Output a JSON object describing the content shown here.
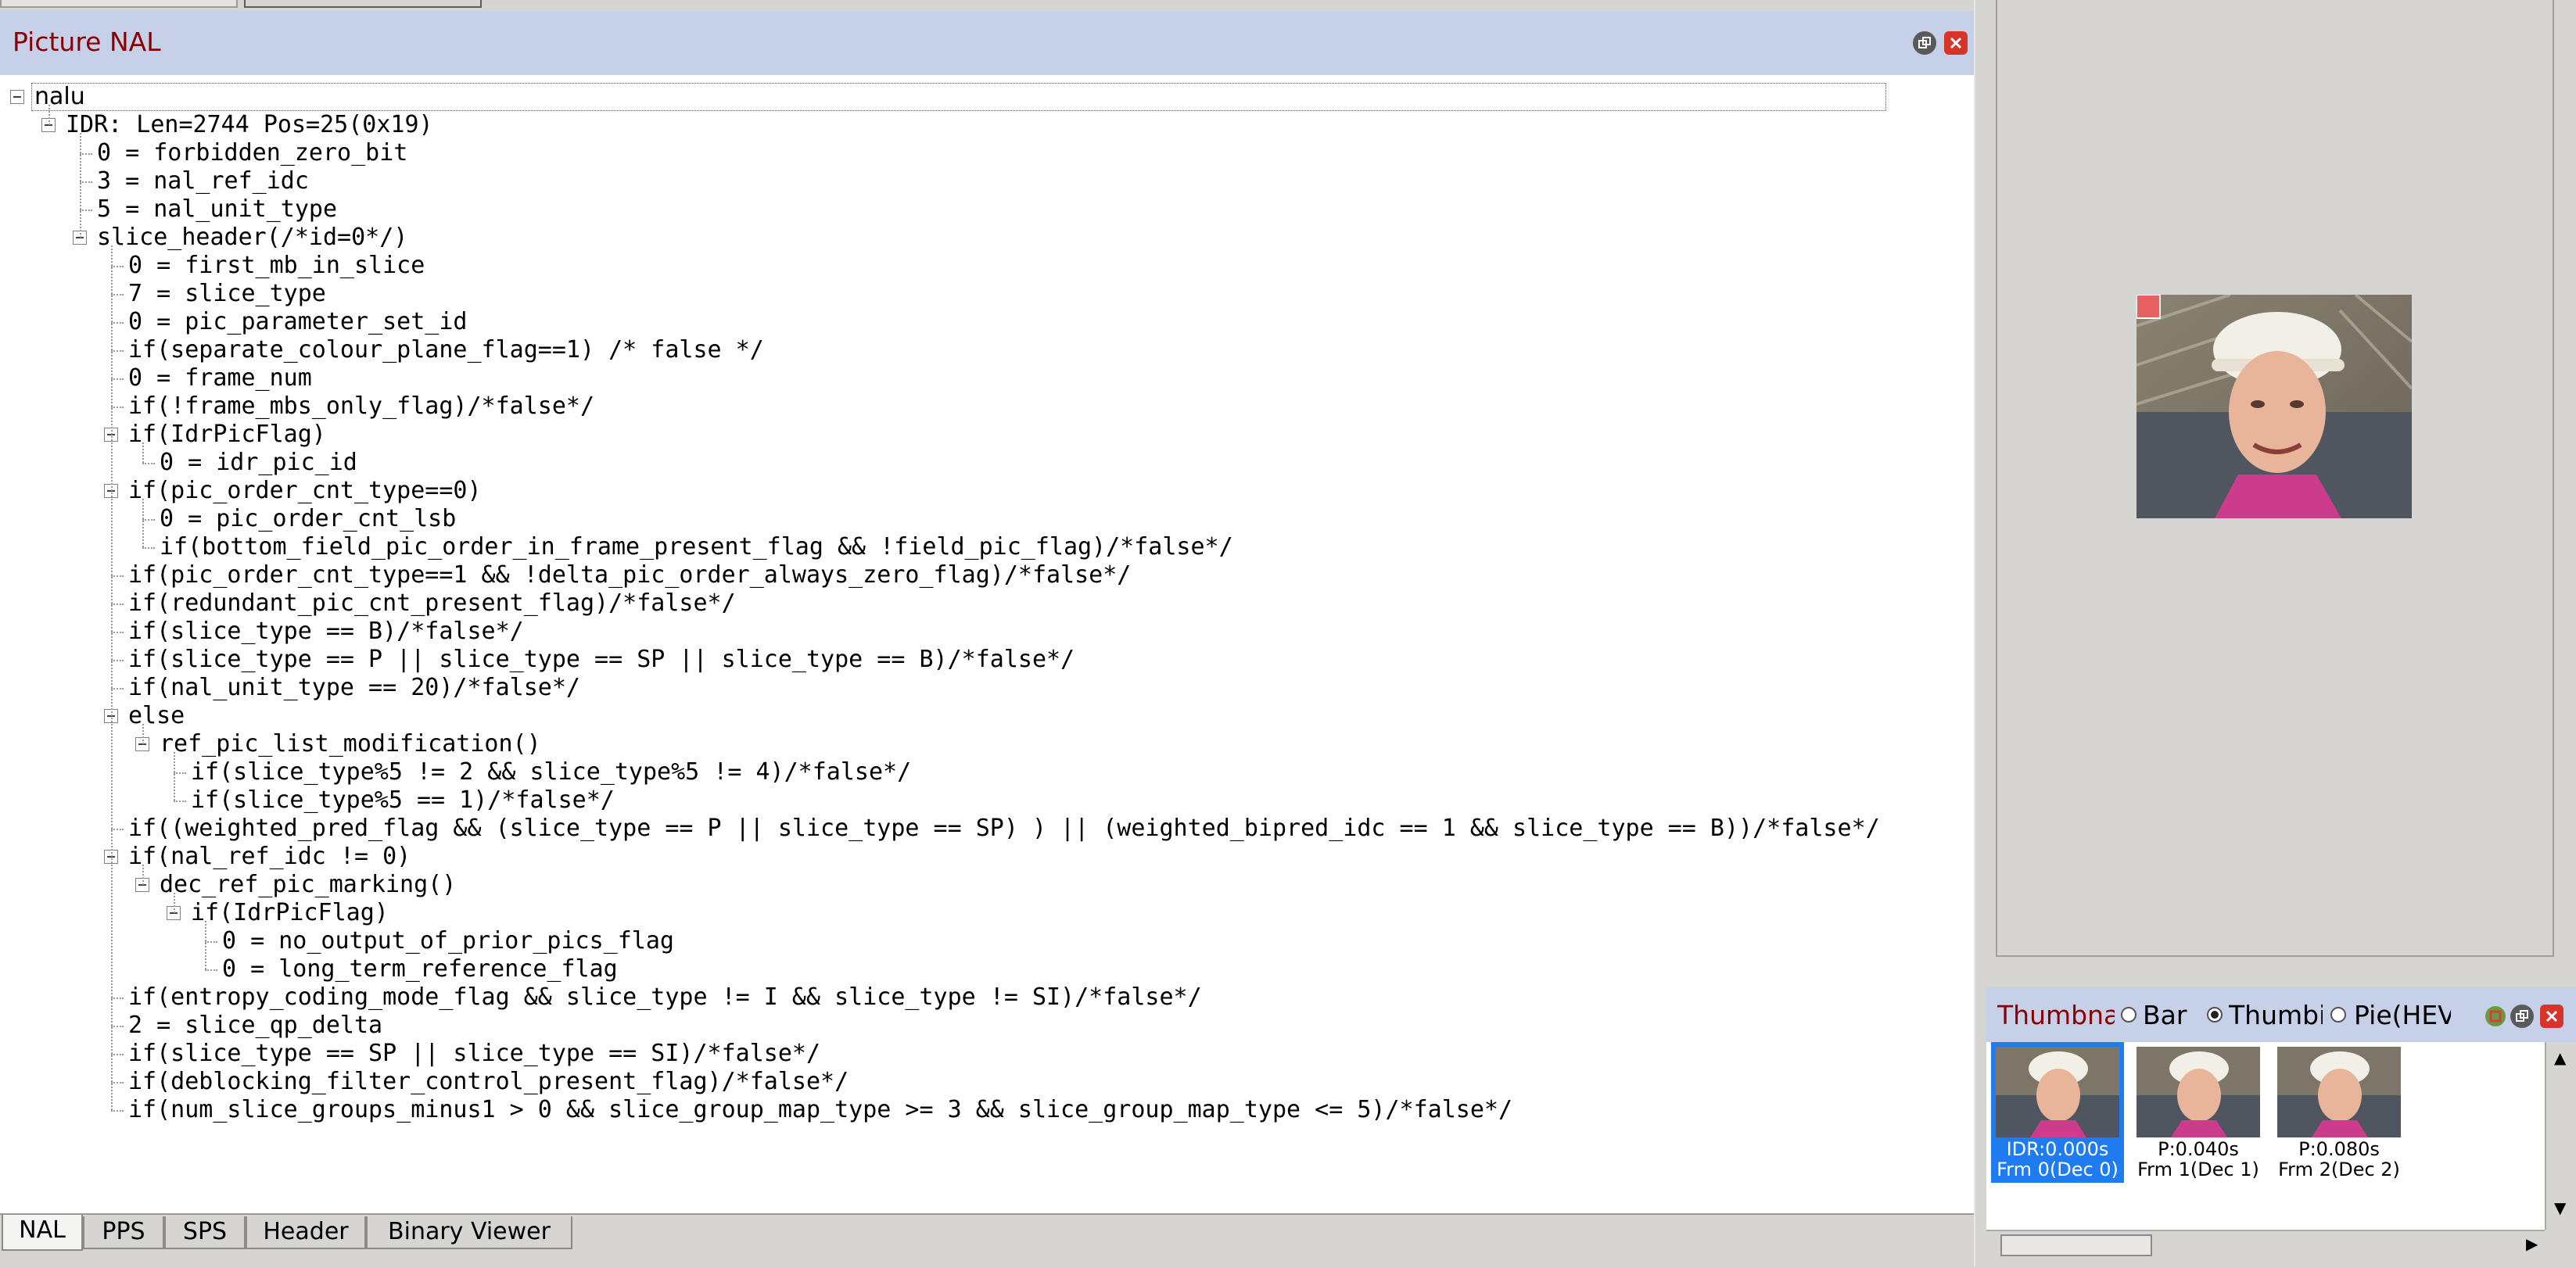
{
  "nal_panel": {
    "title": "Picture NAL",
    "tree": [
      "nalu",
      "IDR: Len=2744 Pos=25(0x19)",
      "0 = forbidden_zero_bit",
      "3 = nal_ref_idc",
      "5 = nal_unit_type",
      "slice_header(/*id=0*/)",
      "0 = first_mb_in_slice",
      "7 = slice_type",
      "0 = pic_parameter_set_id",
      "if(separate_colour_plane_flag==1) /* false */",
      "0 = frame_num",
      "if(!frame_mbs_only_flag)/*false*/",
      "if(IdrPicFlag)",
      "0 = idr_pic_id",
      "if(pic_order_cnt_type==0)",
      "0 = pic_order_cnt_lsb",
      "if(bottom_field_pic_order_in_frame_present_flag && !field_pic_flag)/*false*/",
      "if(pic_order_cnt_type==1 && !delta_pic_order_always_zero_flag)/*false*/",
      "if(redundant_pic_cnt_present_flag)/*false*/",
      "if(slice_type == B)/*false*/",
      "if(slice_type == P || slice_type == SP || slice_type == B)/*false*/",
      "if(nal_unit_type == 20)/*false*/",
      "else",
      "ref_pic_list_modification()",
      "if(slice_type%5 != 2 && slice_type%5 != 4)/*false*/",
      "if(slice_type%5 == 1)/*false*/",
      "if((weighted_pred_flag && (slice_type == P || slice_type == SP) ) || (weighted_bipred_idc == 1 && slice_type == B))/*false*/",
      "if(nal_ref_idc != 0)",
      "dec_ref_pic_marking()",
      "if(IdrPicFlag)",
      "0 = no_output_of_prior_pics_flag",
      "0 = long_term_reference_flag",
      "if(entropy_coding_mode_flag && slice_type != I && slice_type != SI)/*false*/",
      "2 = slice_qp_delta",
      "if(slice_type == SP || slice_type == SI)/*false*/",
      "if(deblocking_filter_control_present_flag)/*false*/",
      "if(num_slice_groups_minus1 > 0 && slice_group_map_type >= 3 && slice_group_map_type <= 5)/*false*/"
    ]
  },
  "bottom_tabs": [
    "NAL",
    "PPS",
    "SPS",
    "Header",
    "Binary Viewer"
  ],
  "active_tab": "NAL",
  "thumbnail_panel": {
    "title": "Thumbnai",
    "view_options": [
      {
        "label": "Bar",
        "checked": false
      },
      {
        "label": "Thumbi",
        "checked": true
      },
      {
        "label": "Pie(HEV",
        "checked": false
      }
    ],
    "thumbnails": [
      {
        "line1": "IDR:0.000s",
        "line2": "Frm 0(Dec 0)",
        "selected": true
      },
      {
        "line1": "P:0.040s",
        "line2": "Frm 1(Dec 1)",
        "selected": false
      },
      {
        "line1": "P:0.080s",
        "line2": "Frm 2(Dec 2)",
        "selected": false
      }
    ]
  },
  "colors": {
    "titlebar": "#c6d0e8",
    "title_text": "#8b0000",
    "selection": "#1e7cf0",
    "close_button": "#d8352a"
  },
  "icons": [
    "expand-collapse-toggle",
    "restore-icon",
    "close-icon",
    "float-icon",
    "radio-button"
  ]
}
